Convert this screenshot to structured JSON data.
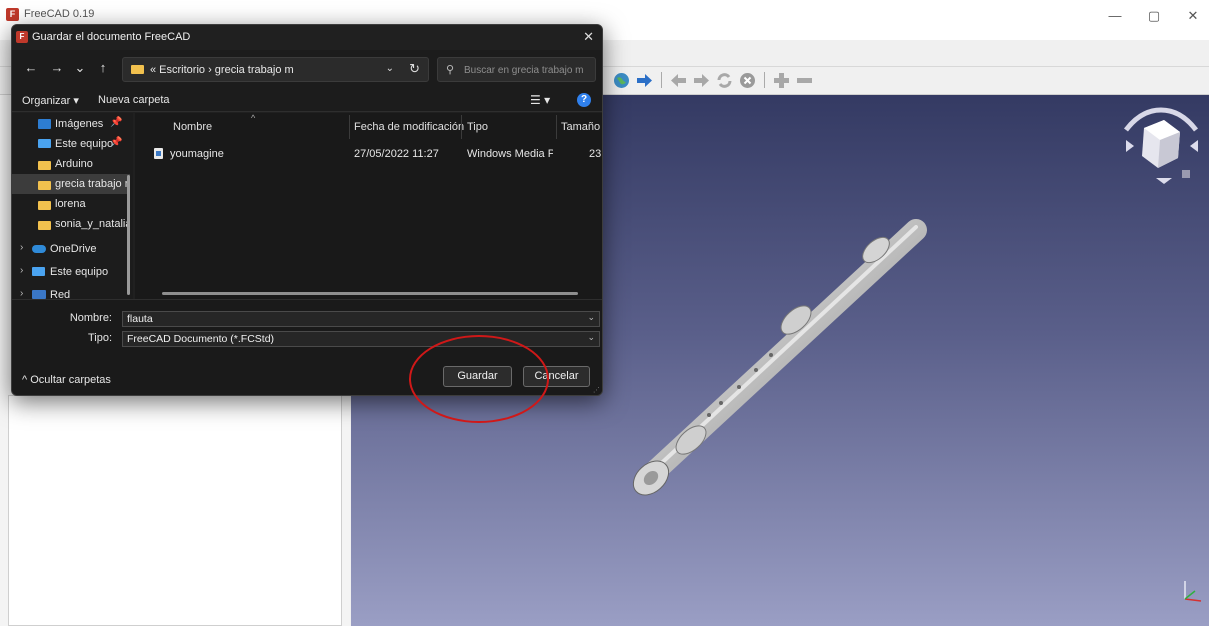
{
  "main_window": {
    "title": "FreeCAD 0.19",
    "app_icon_text": "F",
    "controls": {
      "minimize": "—",
      "maximize": "▢",
      "close": "✕"
    }
  },
  "dialog": {
    "title": "Guardar el documento FreeCAD",
    "icon_text": "F",
    "close": "✕",
    "nav": {
      "back": "←",
      "forward": "→",
      "recent": "⌄",
      "up": "↑"
    },
    "address": {
      "breadcrumb": "« Escritorio  ›  grecia trabajo m",
      "dropdown": "⌄",
      "refresh": "↻"
    },
    "search": {
      "placeholder": "Buscar en grecia trabajo m"
    },
    "toolbar": {
      "organize": "Organizar ▾",
      "new_folder": "Nueva carpeta",
      "view_icon": "☰ ▾",
      "help": "?"
    },
    "navigation_pane": [
      {
        "label": "Imágenes",
        "icon": "image-icon",
        "pinned": true
      },
      {
        "label": "Este equipo",
        "icon": "computer-icon",
        "pinned": true
      },
      {
        "label": "Arduino",
        "icon": "folder-icon"
      },
      {
        "label": "grecia trabajo m",
        "icon": "folder-icon",
        "selected": true
      },
      {
        "label": "lorena",
        "icon": "folder-icon"
      },
      {
        "label": "sonia_y_natalia",
        "icon": "folder-icon"
      },
      {
        "label": "OneDrive",
        "icon": "cloud-icon",
        "expandable": true
      },
      {
        "label": "Este equipo",
        "icon": "computer-icon",
        "expandable": true
      },
      {
        "label": "Red",
        "icon": "network-icon",
        "expandable": true
      }
    ],
    "pin_glyph": "📌",
    "expand_glyph": "›",
    "columns": [
      "Nombre",
      "Fecha de modificación",
      "Tipo",
      "Tamaño"
    ],
    "sort_arrow": "^",
    "files": [
      {
        "name": "youmagine",
        "modified": "27/05/2022 11:27",
        "type": "Windows Media Pl...",
        "size": "23"
      }
    ],
    "form": {
      "name_label": "Nombre:",
      "name_value": "flauta",
      "type_label": "Tipo:",
      "type_value": "FreeCAD Documento (*.FCStd)",
      "dropdown": "⌄"
    },
    "hide_folders": "^  Ocultar carpetas",
    "save_button": "Guardar",
    "cancel_button": "Cancelar"
  },
  "colors": {
    "dialog_bg": "#202020",
    "viewport_top": "#343a63",
    "viewport_bottom": "#9a9ec4",
    "annotation_ring": "#d01818",
    "accent": "#2f80ed"
  }
}
